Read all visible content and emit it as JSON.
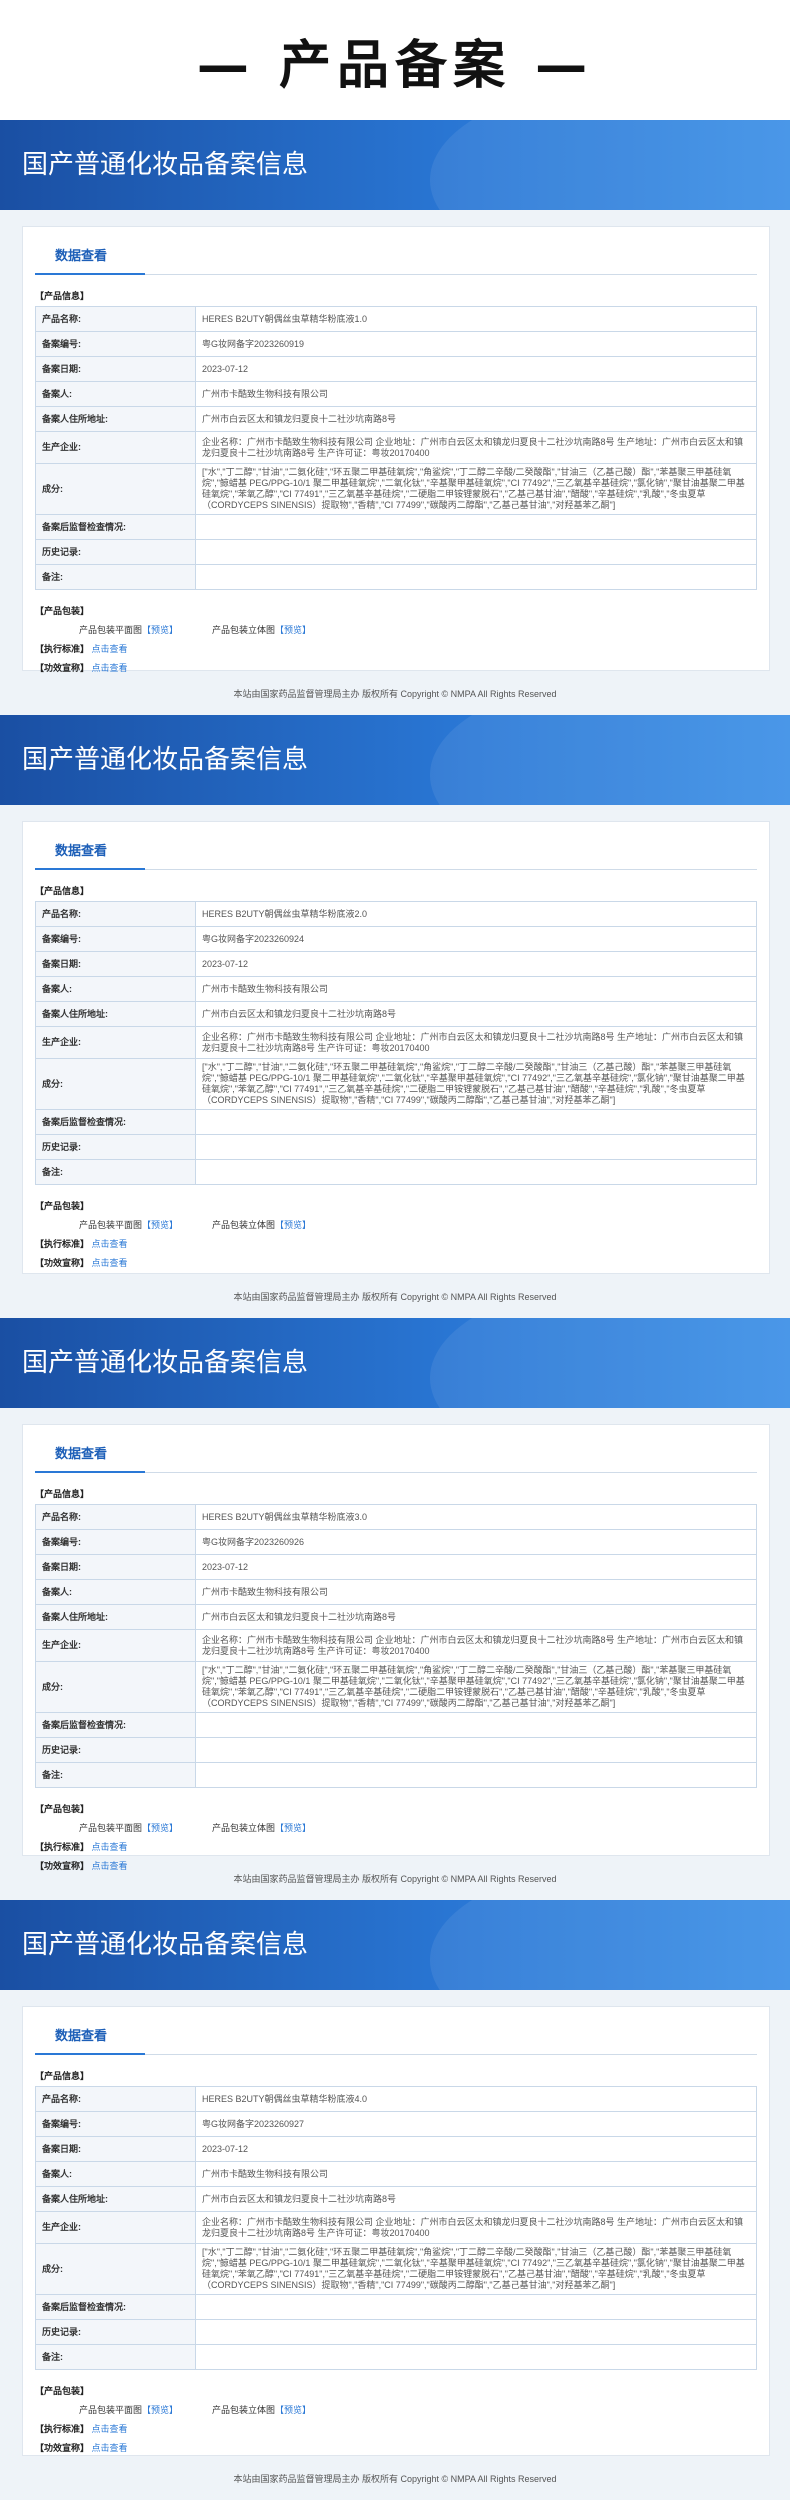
{
  "page": {
    "title": "— 产品备案 —"
  },
  "banner_title": "国产普通化妆品备案信息",
  "tab_label": "数据查看",
  "section_labels": {
    "product_info": "【产品信息】",
    "product_pack": "【产品包装】",
    "exec_standard": "【执行标准】",
    "efficacy": "【功效宣称】"
  },
  "field_labels": {
    "name": "产品名称:",
    "code": "备案编号:",
    "date": "备案日期:",
    "registrant": "备案人:",
    "registrant_addr": "备案人住所地址:",
    "manufacturer": "生产企业:",
    "ingredients": "成分:",
    "post_check": "备案后监督检查情况:",
    "history": "历史记录:",
    "remark": "备注:"
  },
  "pack": {
    "flat": "产品包装平面图",
    "solid": "产品包装立体图",
    "preview": "【预览】"
  },
  "click_view": "点击查看",
  "footer": "本站由国家药品监督管理局主办 版权所有 Copyright © NMPA All Rights Reserved",
  "common": {
    "date": "2023-07-12",
    "registrant": "广州市卡酷致生物科技有限公司",
    "registrant_addr": "广州市白云区太和镇龙归夏良十二社沙坑南路8号",
    "manufacturer": "企业名称：广州市卡酷致生物科技有限公司 企业地址：广州市白云区太和镇龙归夏良十二社沙坑南路8号 生产地址：广州市白云区太和镇龙归夏良十二社沙坑南路8号 生产许可证：粤妆20170400",
    "ingredients": "[\"水\",\"丁二醇\",\"甘油\",\"二氨化硅\",\"环五聚二甲基硅氧烷\",\"角鲨烷\",\"丁二醇二辛酸/二癸酸酯\",\"甘油三（乙基己酸）酯\",\"苯基聚三甲基硅氧烷\",\"鲸蜡基 PEG/PPG-10/1 聚二甲基硅氧烷\",\"二氧化钛\",\"辛基聚甲基硅氧烷\",\"CI 77492\",\"三乙氧基辛基硅烷\",\"氯化钠\",\"聚甘油基聚二甲基硅氧烷\",\"苯氧乙醇\",\"CI 77491\",\"三乙氧基辛基硅烷\",\"二硬脂二甲铵锂蒙脱石\",\"乙基己基甘油\",\"醋酸\",\"辛基硅烷\",\"乳酸\",\"冬虫夏草（CORDYCEPS SINENSIS）提取物\",\"香精\",\"CI 77499\",\"碳酸丙二醇酯\",\"乙基己基甘油\",\"对羟基苯乙酮\"]"
  },
  "records": [
    {
      "name": "HERES B2UTY朝偶丝虫草精华粉底液1.0",
      "code": "粤G妆网备字2023260919"
    },
    {
      "name": "HERES B2UTY朝偶丝虫草精华粉底液2.0",
      "code": "粤G妆网备字2023260924"
    },
    {
      "name": "HERES B2UTY朝偶丝虫草精华粉底液3.0",
      "code": "粤G妆网备字2023260926"
    },
    {
      "name": "HERES B2UTY朝偶丝虫草精华粉底液4.0",
      "code": "粤G妆网备字2023260927"
    }
  ]
}
